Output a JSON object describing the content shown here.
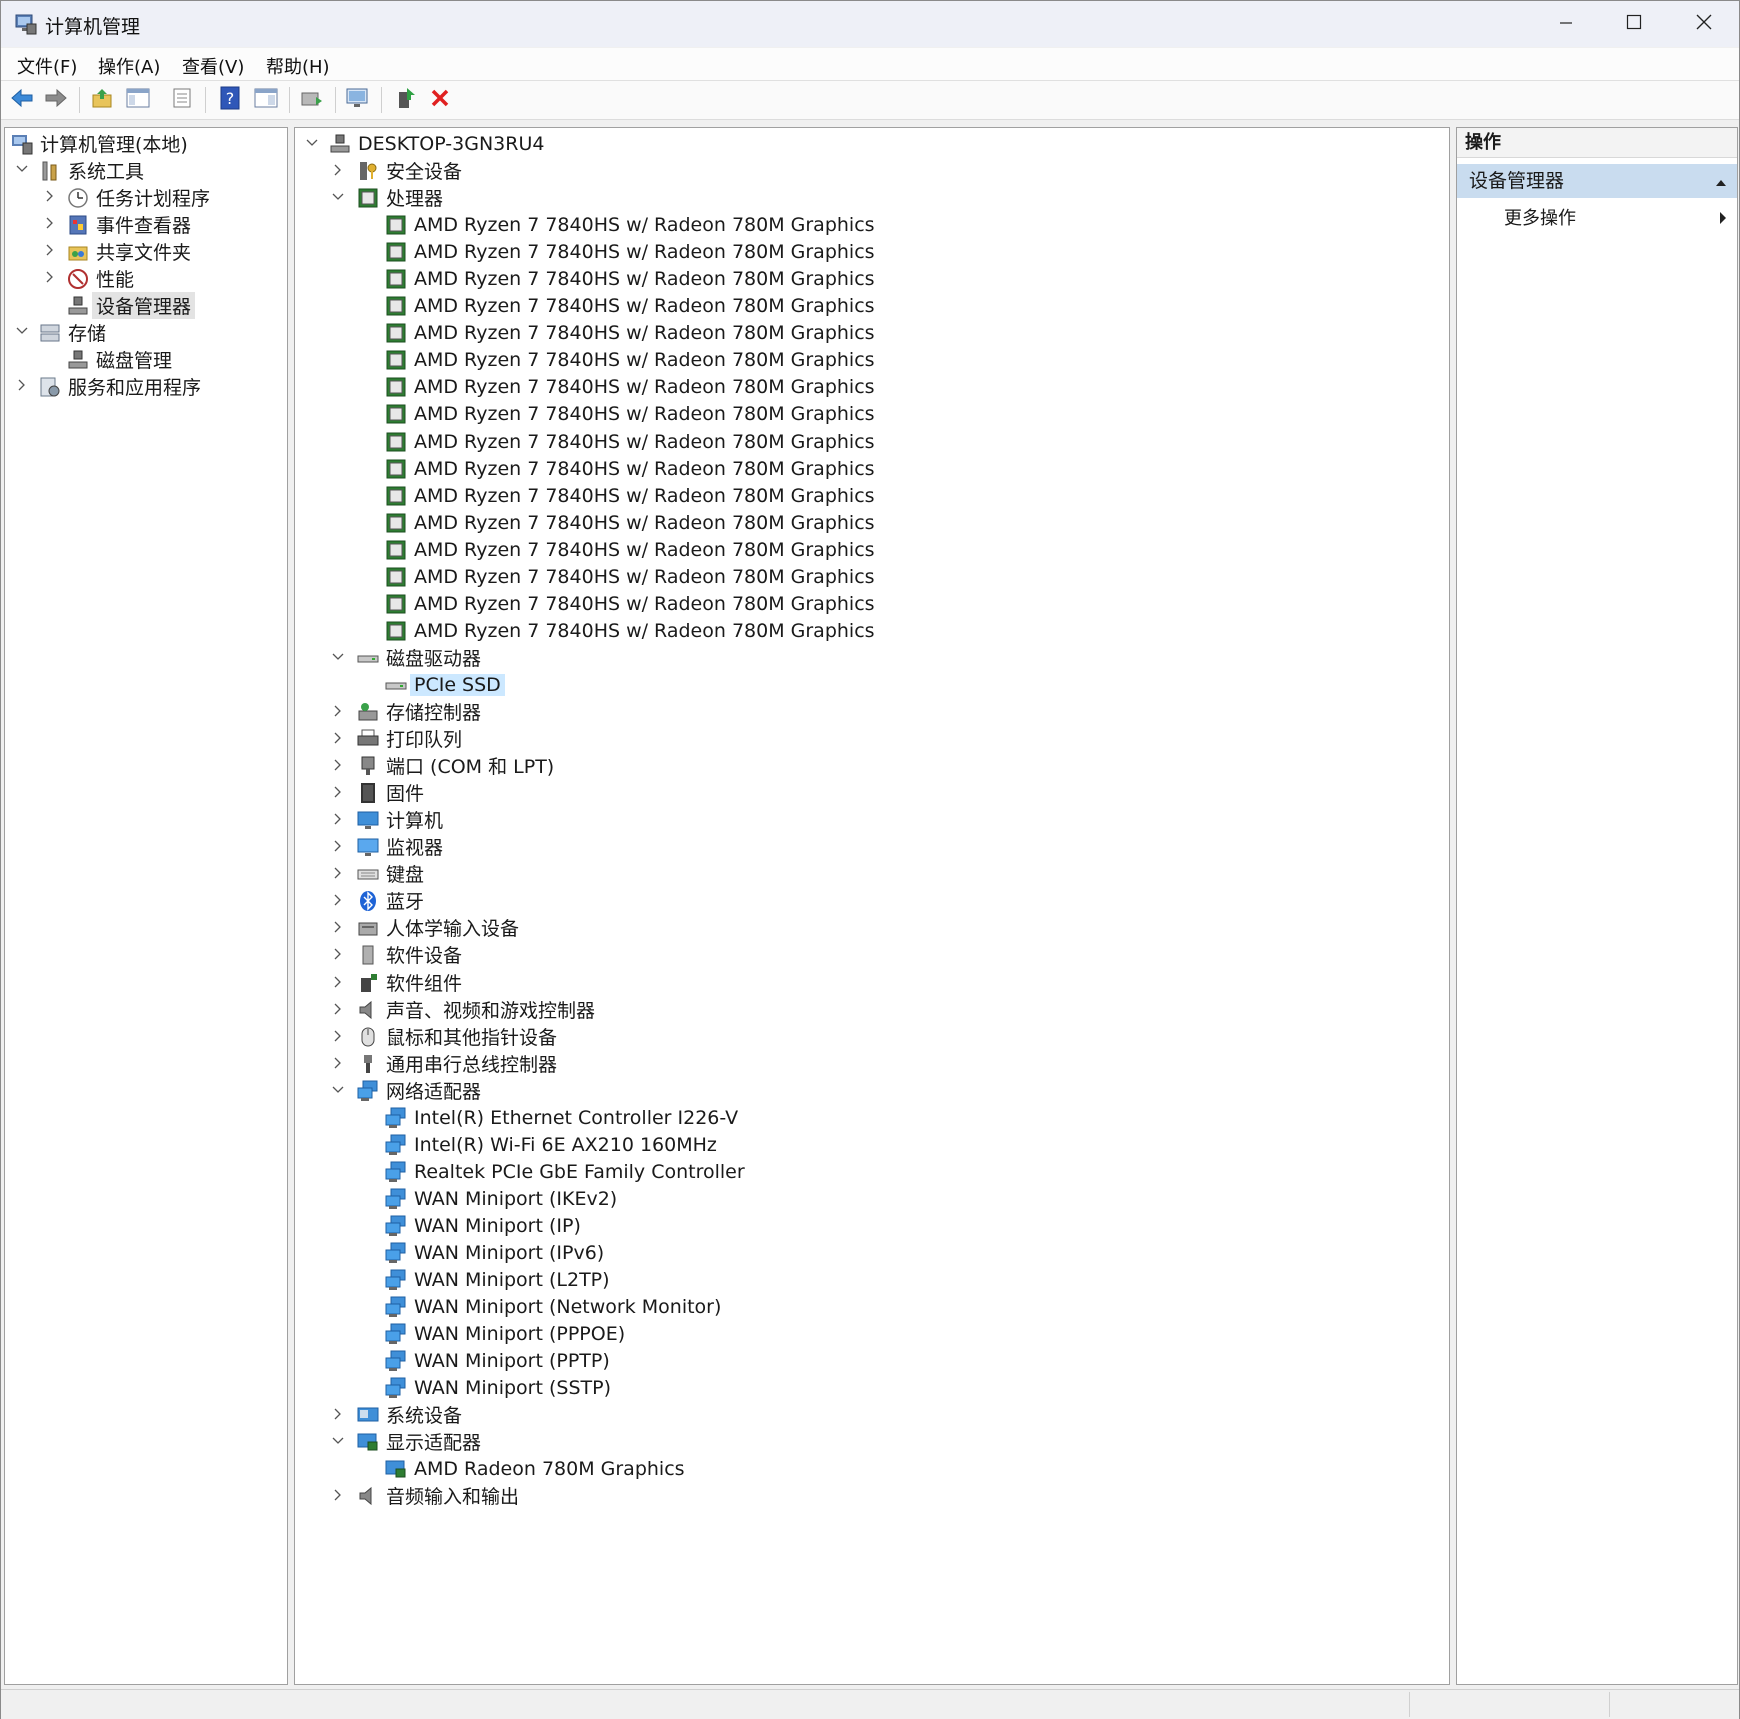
{
  "window": {
    "title": "计算机管理",
    "minimize_icon": "minimize-icon",
    "maximize_icon": "maximize-icon",
    "close_icon": "close-icon"
  },
  "menu": [
    "文件(F)",
    "操作(A)",
    "查看(V)",
    "帮助(H)"
  ],
  "toolbar": [
    "back-icon",
    "forward-icon",
    "up-folder-icon",
    "show-hide-tree-icon",
    "properties-icon",
    "help-icon",
    "show-hide-action-icon",
    "update-driver-icon",
    "scan-hardware-icon",
    "enable-device-icon",
    "uninstall-icon"
  ],
  "left_tree": [
    {
      "label": "计算机管理(本地)",
      "icon": "computer-management-icon"
    },
    {
      "label": "系统工具",
      "icon": "system-tools-icon"
    },
    {
      "label": "任务计划程序",
      "icon": "task-scheduler-icon"
    },
    {
      "label": "事件查看器",
      "icon": "event-viewer-icon"
    },
    {
      "label": "共享文件夹",
      "icon": "shared-folders-icon"
    },
    {
      "label": "性能",
      "icon": "performance-icon"
    },
    {
      "label": "设备管理器",
      "icon": "device-manager-icon"
    },
    {
      "label": "存储",
      "icon": "storage-icon"
    },
    {
      "label": "磁盘管理",
      "icon": "disk-management-icon"
    },
    {
      "label": "服务和应用程序",
      "icon": "services-apps-icon"
    }
  ],
  "device_tree": {
    "root": "DESKTOP-3GN3RU4",
    "security": "安全设备",
    "processors": "处理器",
    "cpu_name": "AMD Ryzen 7 7840HS w/ Radeon 780M Graphics",
    "disk_drives": "磁盘驱动器",
    "disk_item": "PCIe SSD",
    "storage_controllers": "存储控制器",
    "print_queues": "打印队列",
    "ports": "端口 (COM 和 LPT)",
    "firmware": "固件",
    "computer": "计算机",
    "monitors": "监视器",
    "keyboards": "键盘",
    "bluetooth": "蓝牙",
    "hid": "人体学输入设备",
    "software_devices": "软件设备",
    "software_components": "软件组件",
    "sound": "声音、视频和游戏控制器",
    "mice": "鼠标和其他指针设备",
    "usb": "通用串行总线控制器",
    "network_adapters": "网络适配器",
    "network_items": [
      "Intel(R) Ethernet Controller I226-V",
      "Intel(R) Wi-Fi 6E AX210 160MHz",
      "Realtek PCIe GbE Family Controller",
      "WAN Miniport (IKEv2)",
      "WAN Miniport (IP)",
      "WAN Miniport (IPv6)",
      "WAN Miniport (L2TP)",
      "WAN Miniport (Network Monitor)",
      "WAN Miniport (PPPOE)",
      "WAN Miniport (PPTP)",
      "WAN Miniport (SSTP)"
    ],
    "system_devices": "系统设备",
    "display_adapters": "显示适配器",
    "display_item": "AMD Radeon 780M Graphics",
    "audio_io": "音频输入和输出"
  },
  "actions": {
    "header": "操作",
    "section": "设备管理器",
    "more": "更多操作"
  }
}
